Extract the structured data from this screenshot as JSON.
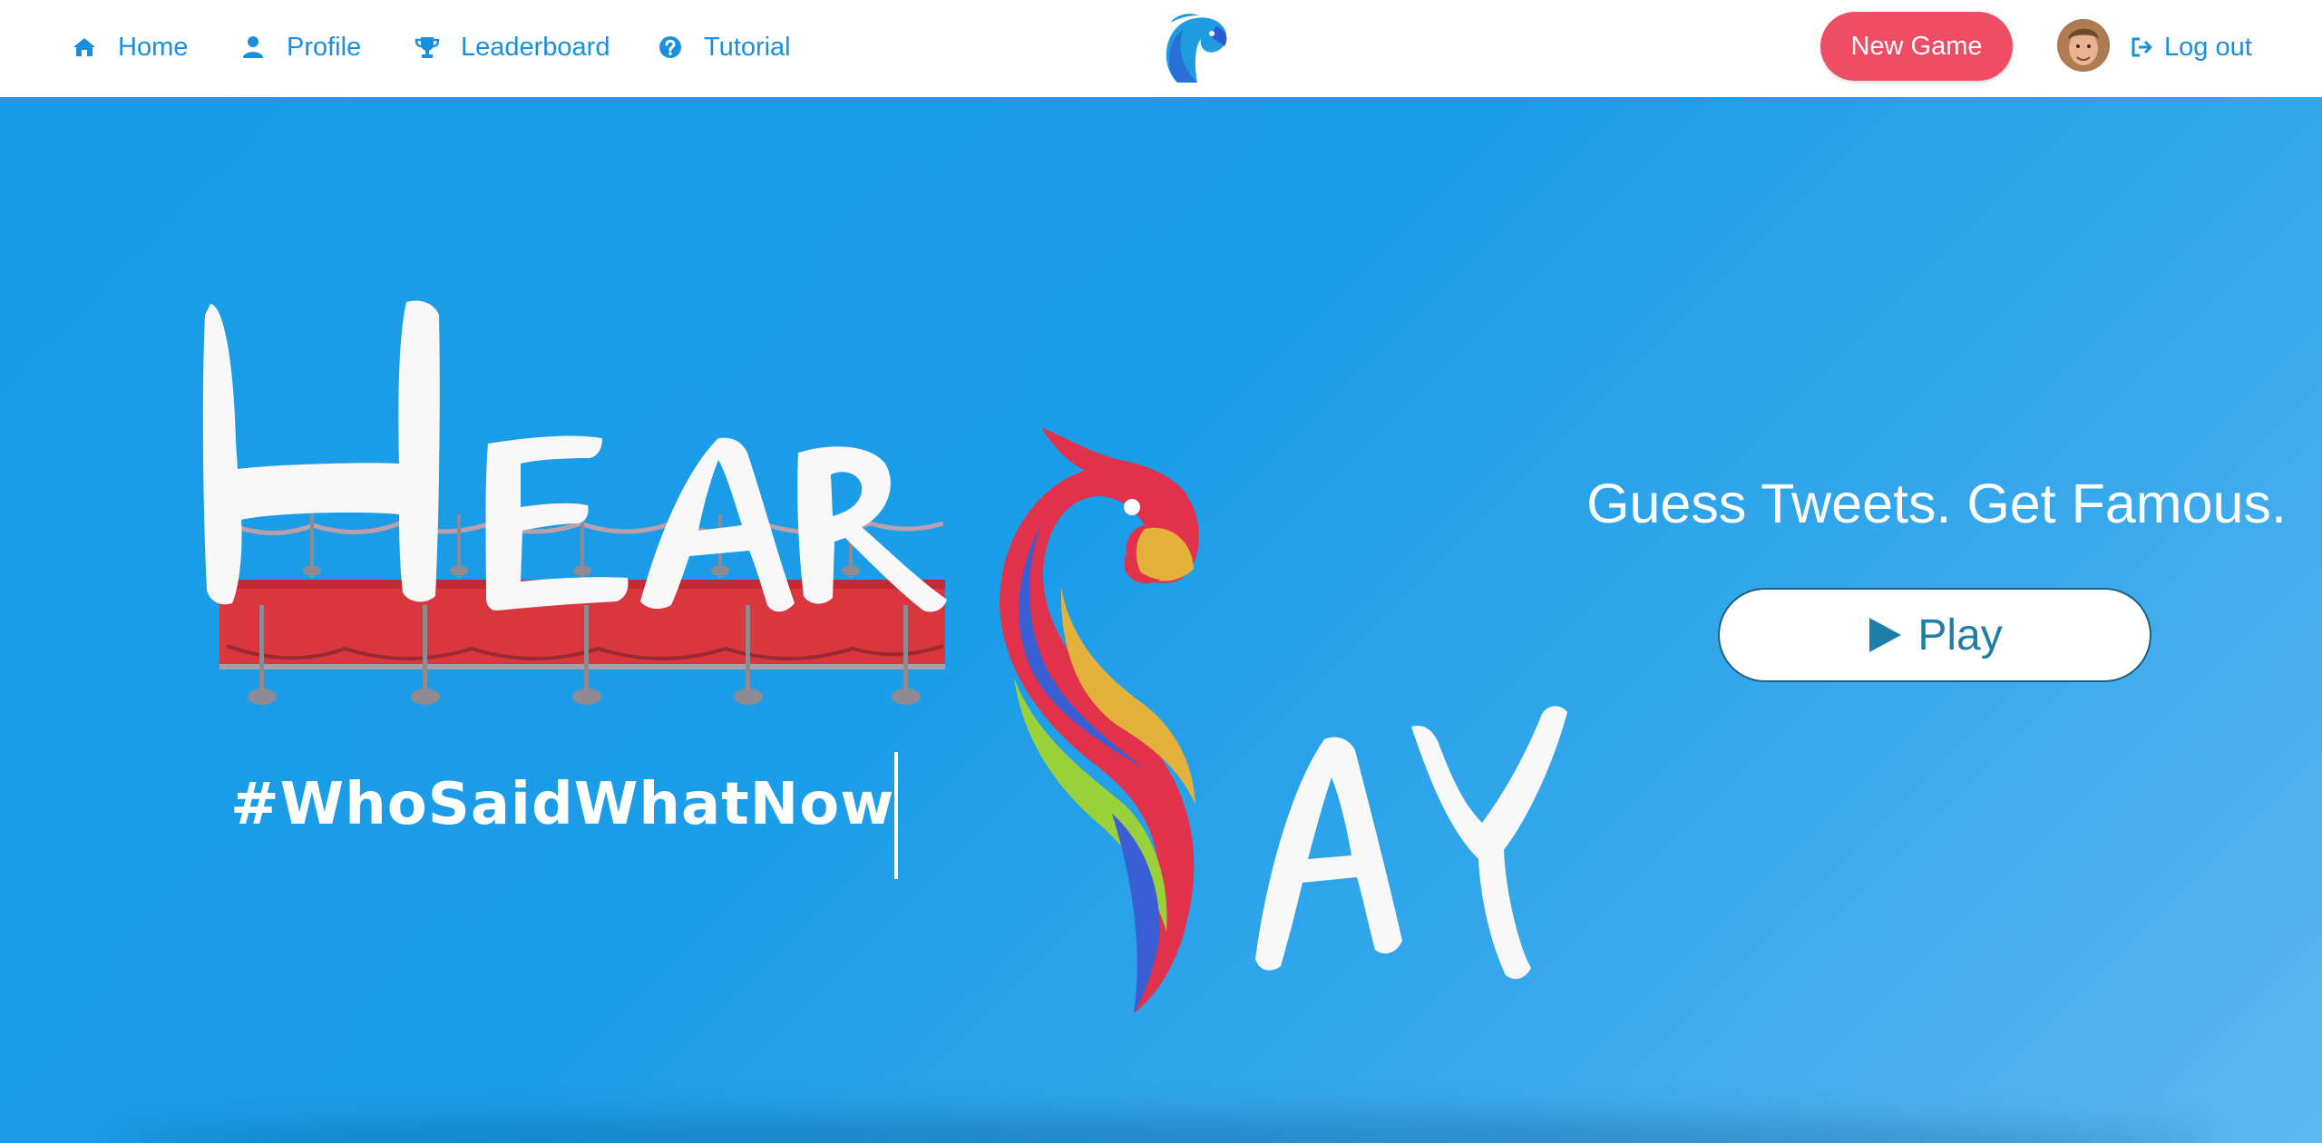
{
  "nav": {
    "home": "Home",
    "profile": "Profile",
    "leaderboard": "Leaderboard",
    "tutorial": "Tutorial",
    "new_game": "New Game",
    "logout": "Log out"
  },
  "hero": {
    "logo_word_left": "HEAR",
    "logo_word_right": "AY",
    "hashtag": "#WhoSaidWhatNow",
    "tagline": "Guess Tweets. Get Famous.",
    "play_label": "Play"
  },
  "icons": {
    "home": "home-icon",
    "profile": "user-icon",
    "leaderboard": "trophy-icon",
    "tutorial": "question-circle-icon",
    "logout": "sign-out-icon",
    "play": "play-icon",
    "brand": "parrot-logo"
  },
  "colors": {
    "nav_link": "#1a8fdd",
    "new_game_button": "#ee4d64",
    "hero_background": "#1c9de8",
    "play_text": "#1d7fa8",
    "red_carpet": "#d9363e"
  }
}
